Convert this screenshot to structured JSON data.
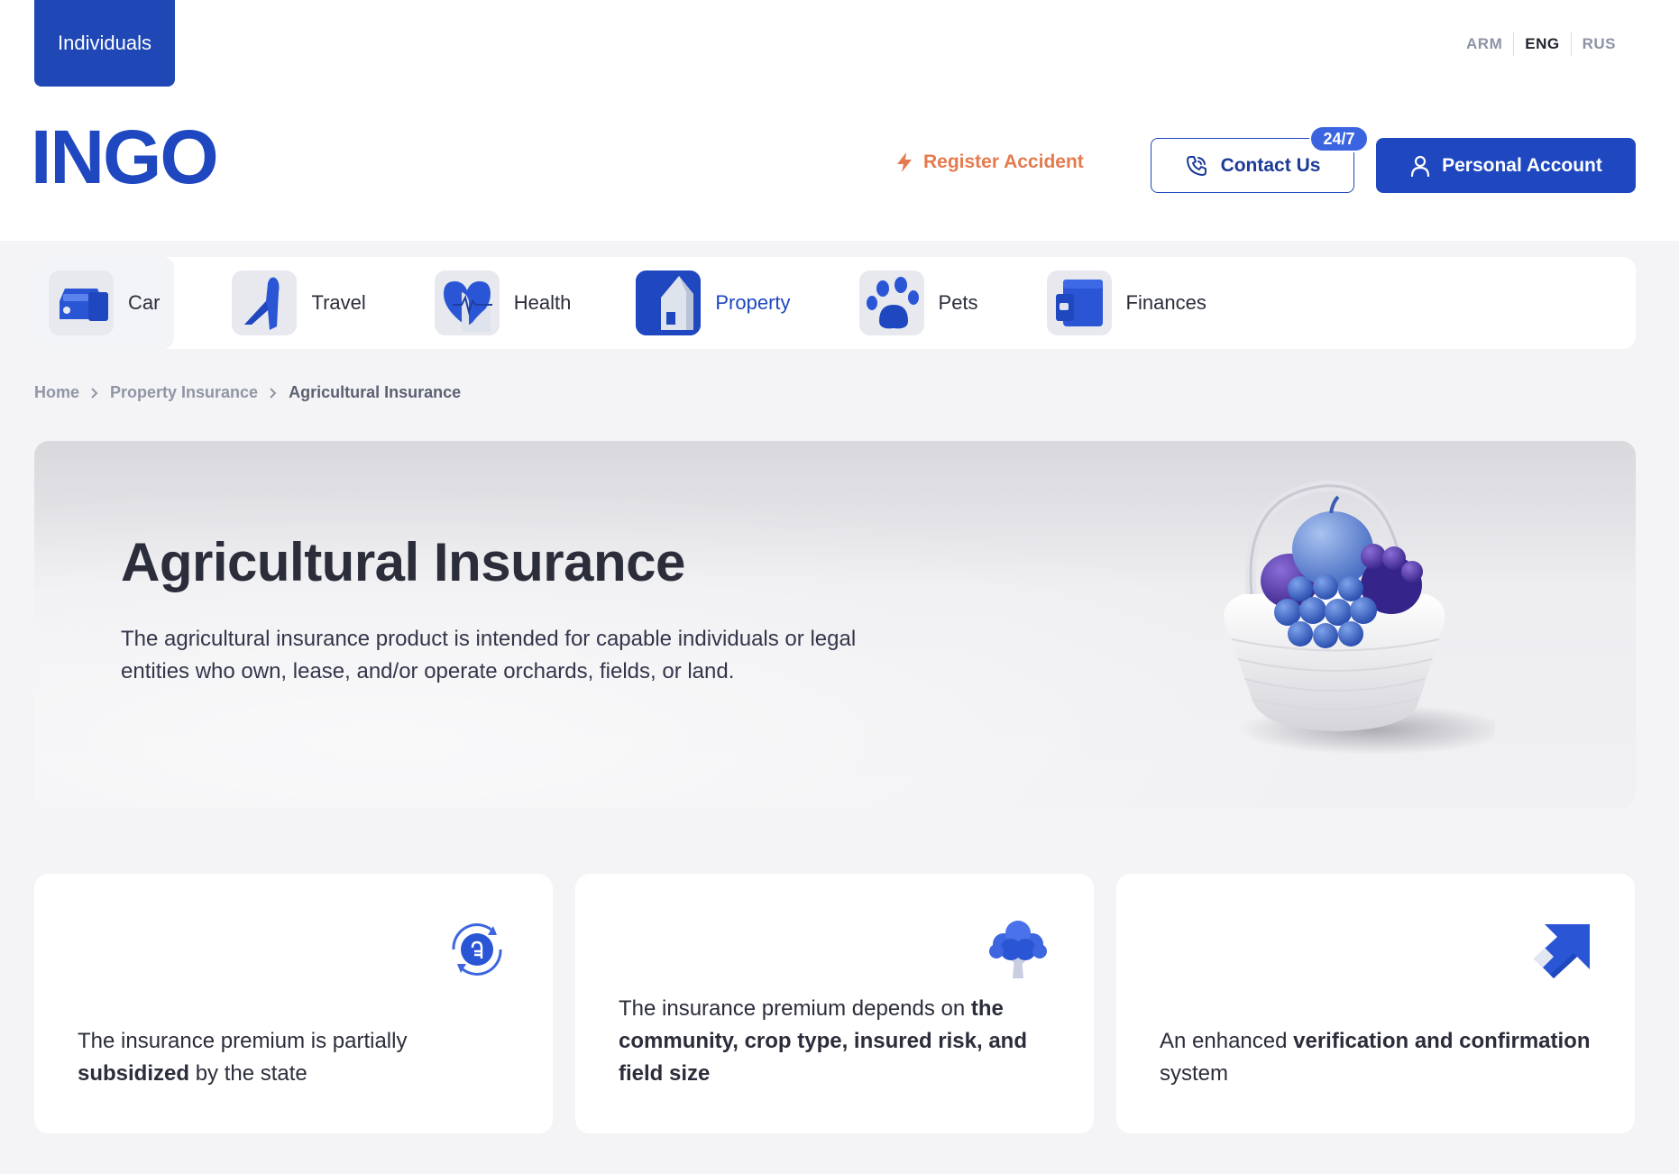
{
  "header": {
    "segment_tab": "Individuals",
    "languages": [
      {
        "code": "ARM",
        "active": false
      },
      {
        "code": "ENG",
        "active": true
      },
      {
        "code": "RUS",
        "active": false
      }
    ],
    "logo": "INGO",
    "register_accident": "Register Accident",
    "contact_us": "Contact Us",
    "contact_badge": "24/7",
    "personal_account": "Personal Account"
  },
  "categories": [
    {
      "label": "Car",
      "icon": "car-icon"
    },
    {
      "label": "Travel",
      "icon": "airplane-icon"
    },
    {
      "label": "Health",
      "icon": "heart-pulse-icon"
    },
    {
      "label": "Property",
      "icon": "house-icon",
      "active": true
    },
    {
      "label": "Pets",
      "icon": "paw-icon"
    },
    {
      "label": "Finances",
      "icon": "wallet-icon"
    }
  ],
  "breadcrumb": [
    "Home",
    "Property Insurance",
    "Agricultural Insurance"
  ],
  "hero": {
    "title": "Agricultural Insurance",
    "description": "The agricultural insurance product is intended for capable individuals or legal entities who own, lease, and/or operate orchards, fields, or land."
  },
  "features": [
    {
      "icon": "dram-coin-cycle-icon",
      "pre": "The insurance premium is partially ",
      "bold": "subsidized",
      "post": " by the state"
    },
    {
      "icon": "tree-icon",
      "pre": "The insurance premium depends on ",
      "bold": "the community, crop type, insured risk, and field size",
      "post": ""
    },
    {
      "icon": "arrow-badge-icon",
      "pre": "An enhanced ",
      "bold": "verification and confirmation",
      "post": " system"
    }
  ],
  "colors": {
    "brand": "#1e47c0",
    "accent": "#e47a4e",
    "background": "#f4f4f6"
  }
}
